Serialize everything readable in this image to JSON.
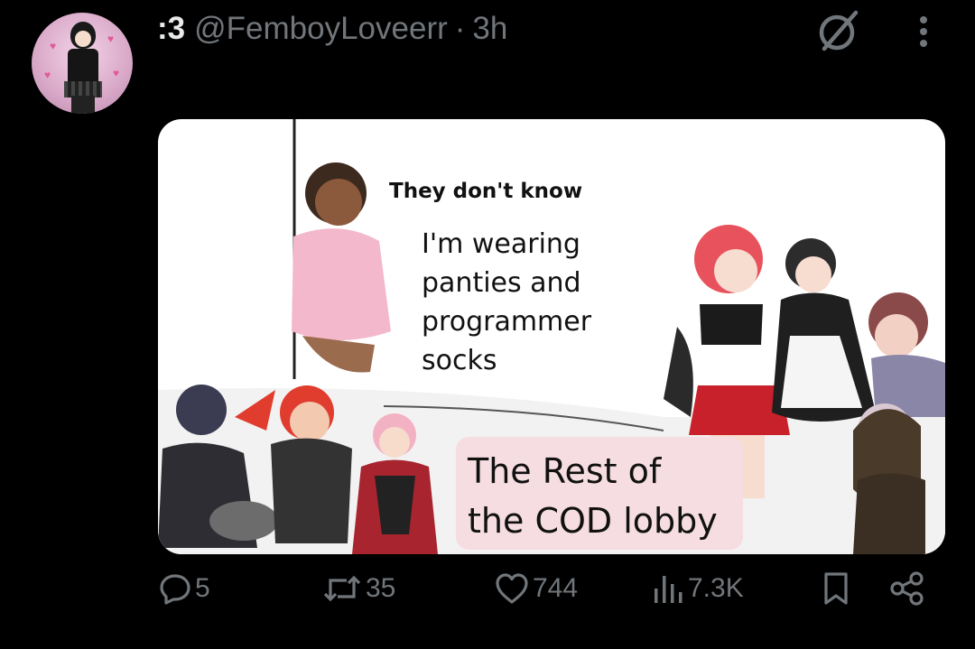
{
  "post": {
    "display_name": ":3",
    "handle": "@FemboyLoveerr",
    "separator": "·",
    "time": "3h"
  },
  "meme": {
    "title": "They don't know",
    "body_lines": [
      "I'm wearing",
      "panties and",
      "programmer",
      "socks"
    ],
    "rest_lines": [
      "The Rest of",
      "the COD lobby"
    ]
  },
  "actions": {
    "replies": "5",
    "reposts": "35",
    "likes": "744",
    "views": "7.3K"
  },
  "icons": {
    "header": [
      "grok-icon",
      "more-icon"
    ],
    "actions": [
      "reply-icon",
      "repost-icon",
      "like-icon",
      "views-icon",
      "bookmark-icon",
      "share-icon"
    ]
  },
  "colors": {
    "background": "#000000",
    "primary_text": "#e7e9ea",
    "secondary_text": "#71767b",
    "meme_rest_box": "#f6dde1"
  }
}
